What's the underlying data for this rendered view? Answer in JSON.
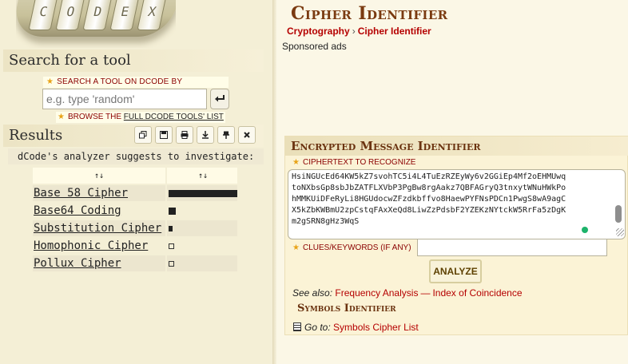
{
  "sidebar": {
    "logo_letters": [
      "C",
      "O",
      "D",
      "E",
      "X"
    ],
    "search": {
      "heading": "Search for a tool",
      "label": "SEARCH A TOOL ON DCODE BY KEYWORDS:",
      "placeholder": "e.g. type 'random'",
      "browse_prefix": "BROWSE THE",
      "browse_link": "FULL DCODE TOOLS' LIST"
    },
    "results": {
      "heading": "Results",
      "analyzer_text": "dCode's analyzer suggests to investigate:",
      "col_headers": [
        "↑↓",
        "↑↓"
      ],
      "rows": [
        {
          "name": "Base 58 Cipher",
          "score": 1.0
        },
        {
          "name": "Base64 Coding",
          "score": 0.1
        },
        {
          "name": "Substitution Cipher",
          "score": 0.06
        },
        {
          "name": "Homophonic Cipher",
          "score": 0
        },
        {
          "name": "Pollux Cipher",
          "score": 0
        }
      ]
    }
  },
  "main": {
    "title": "Cipher Identifier",
    "breadcrumb": [
      "Cryptography",
      "Cipher Identifier"
    ],
    "breadcrumb_sep": "›",
    "sponsored": "Sponsored ads",
    "tool": {
      "title": "Encrypted Message Identifier",
      "ciphertext_label": "CIPHERTEXT TO RECOGNIZE",
      "ciphertext_lines": [
        "HsiNGUcEd64KW5kZ7svohTC5i4L4TuEzRZEyWy6v2GGiEp4Mf2oEHMUwq",
        "toNXbsGp8sbJbZATFLXVbP3PgBw8rgAakz7QBFAGryQ3tnxytWNuHWkPo",
        "hMMKUiDFeRyLi8HGUdocwZFzdkbffvo8HaewPYFNsPDCn1PwgS8wA9agC",
        "X5kZbKWBmU2zpCstqFAxXeQd8LiwZzPdsbF2YZEKzNYtckW5RrFa5zDgK",
        "m2gSRN8gHz3WqS"
      ],
      "clues_label": "CLUES/KEYWORDS (IF ANY)",
      "clues_value": "",
      "analyze_label": "ANALYZE",
      "see_also_label": "See also:",
      "see_also_links": [
        "Frequency Analysis",
        "Index of Coincidence"
      ],
      "see_also_sep": "—",
      "symbols_title": "Symbols Identifier",
      "goto_label": "Go to:",
      "goto_link": "Symbols Cipher List"
    }
  },
  "icons": {
    "search_go": "enter-arrow-icon",
    "toolbar": [
      "copy-icon",
      "save-icon",
      "print-icon",
      "download-icon",
      "pin-icon",
      "close-icon"
    ]
  }
}
